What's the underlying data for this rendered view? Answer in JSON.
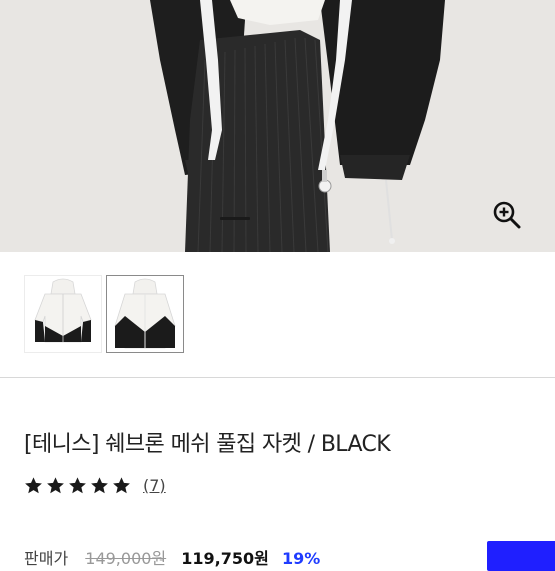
{
  "product": {
    "title": "[테니스] 쉐브론 메쉬 풀집 자켓 / BLACK",
    "rating_stars": 5,
    "rating_max": 5,
    "review_count": "(7)",
    "price_label": "판매가",
    "original_price": "149,000원",
    "sale_price": "119,750원",
    "discount": "19%"
  },
  "gallery": {
    "thumbnails": [
      {
        "label": "thumbnail-1",
        "selected": false
      },
      {
        "label": "thumbnail-2",
        "selected": true
      }
    ]
  },
  "icons": {
    "zoom": "zoom-in-icon",
    "star": "star-icon"
  },
  "colors": {
    "accent": "#1f1fff",
    "star": "#1a1a1a",
    "jacket_dark": "#1b1b1b",
    "jacket_light": "#f2f1ee",
    "background_hero": "#e9e7e4"
  }
}
